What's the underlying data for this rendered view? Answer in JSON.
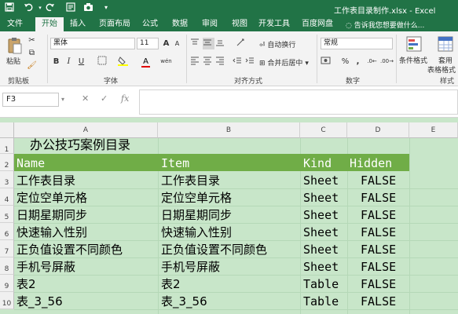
{
  "titlebar": {
    "title": "工作表目录制作.xlsx - Excel",
    "quick_access": [
      "save-icon",
      "undo-icon",
      "redo-icon",
      "print-preview-icon",
      "camera-icon",
      "customize-icon"
    ]
  },
  "tabs": {
    "items": [
      "文件",
      "开始",
      "插入",
      "页面布局",
      "公式",
      "数据",
      "审阅",
      "视图",
      "开发工具",
      "百度网盘"
    ],
    "active": "开始",
    "tell_me": "告诉我您想要做什么..."
  },
  "ribbon": {
    "clipboard": {
      "paste": "粘贴",
      "label": "剪贴板"
    },
    "font": {
      "name": "黑体",
      "size": "11",
      "bold": "B",
      "italic": "I",
      "underline": "U",
      "grow": "A",
      "shrink": "A",
      "color_letter": "A",
      "wen": "wén",
      "label": "字体"
    },
    "alignment": {
      "wrap": "自动换行",
      "merge": "合并后居中",
      "label": "对齐方式"
    },
    "number": {
      "format": "常规",
      "percent": "%",
      "comma": ",",
      "label": "数字"
    },
    "styles": {
      "conditional": "条件格式",
      "table": "套用",
      "table2": "表格格式",
      "label": "样式"
    }
  },
  "formula_bar": {
    "name_box": "F3",
    "cancel": "✕",
    "enter": "✓",
    "fx": "fx",
    "value": ""
  },
  "sheet": {
    "columns": [
      "A",
      "B",
      "C",
      "D",
      "E"
    ],
    "rows": [
      "1",
      "2",
      "3",
      "4",
      "5",
      "6",
      "7",
      "8",
      "9",
      "10"
    ],
    "title": "办公技巧案例目录",
    "headers": [
      "Name",
      "Item",
      "Kind",
      "Hidden"
    ],
    "data": [
      [
        "工作表目录",
        "工作表目录",
        "Sheet",
        "FALSE"
      ],
      [
        "定位空单元格",
        "定位空单元格",
        "Sheet",
        "FALSE"
      ],
      [
        "日期星期同步",
        "日期星期同步",
        "Sheet",
        "FALSE"
      ],
      [
        "快速输入性别",
        "快速输入性别",
        "Sheet",
        "FALSE"
      ],
      [
        "正负值设置不同颜色",
        "正负值设置不同颜色",
        "Sheet",
        "FALSE"
      ],
      [
        "手机号屏蔽",
        "手机号屏蔽",
        "Sheet",
        "FALSE"
      ],
      [
        "表2",
        "表2",
        "Table",
        "FALSE"
      ],
      [
        "表_3_56",
        "表_3_56",
        "Table",
        "FALSE"
      ]
    ]
  },
  "colors": {
    "excel_green": "#217346",
    "header_band": "#70ad47",
    "cell_fill": "#c8e6c9"
  }
}
